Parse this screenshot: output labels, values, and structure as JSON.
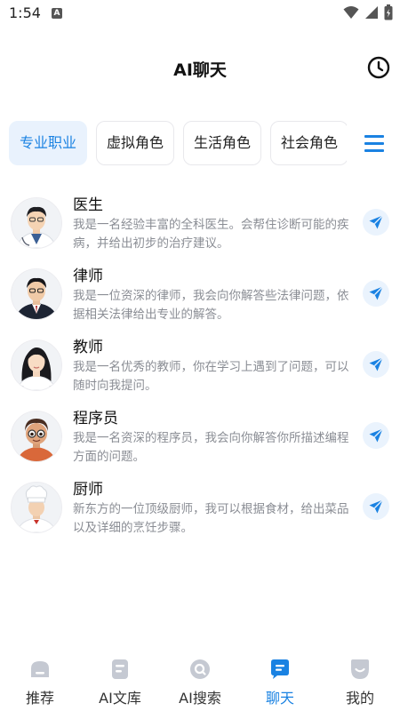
{
  "status_bar": {
    "time": "1:54",
    "app_indicator": "A"
  },
  "header": {
    "title": "AI聊天"
  },
  "tabs": [
    {
      "label": "专业职业",
      "active": true
    },
    {
      "label": "虚拟角色",
      "active": false
    },
    {
      "label": "生活角色",
      "active": false
    },
    {
      "label": "社会角色",
      "active": false
    }
  ],
  "roles": [
    {
      "name": "医生",
      "description": "我是一名经验丰富的全科医生。会帮住诊断可能的疾病，并给出初步的治疗建议。",
      "avatar_icon": "doctor-avatar"
    },
    {
      "name": "律师",
      "description": "我是一位资深的律师，我会向你解答些法律问题，依据相关法律给出专业的解答。",
      "avatar_icon": "lawyer-avatar"
    },
    {
      "name": "教师",
      "description": "我是一名优秀的教师，你在学习上遇到了问题，可以随时向我提问。",
      "avatar_icon": "teacher-avatar"
    },
    {
      "name": "程序员",
      "description": "我是一名资深的程序员，我会向你解答你所描述编程方面的问题。",
      "avatar_icon": "programmer-avatar"
    },
    {
      "name": "厨师",
      "description": "新东方的一位顶级厨师，我可以根据食材，给出菜品以及详细的烹饪步骤。",
      "avatar_icon": "chef-avatar"
    }
  ],
  "bottom_nav": [
    {
      "label": "推荐",
      "icon": "home-icon",
      "active": false
    },
    {
      "label": "AI文库",
      "icon": "document-icon",
      "active": false
    },
    {
      "label": "AI搜索",
      "icon": "search-icon",
      "active": false
    },
    {
      "label": "聊天",
      "icon": "chat-icon",
      "active": true
    },
    {
      "label": "我的",
      "icon": "profile-icon",
      "active": false
    }
  ],
  "colors": {
    "accent": "#1a82e2",
    "accent_bg": "#e9f2fd",
    "desc_text": "#8a8d94",
    "nav_inactive_icon": "#c5c9d2"
  }
}
